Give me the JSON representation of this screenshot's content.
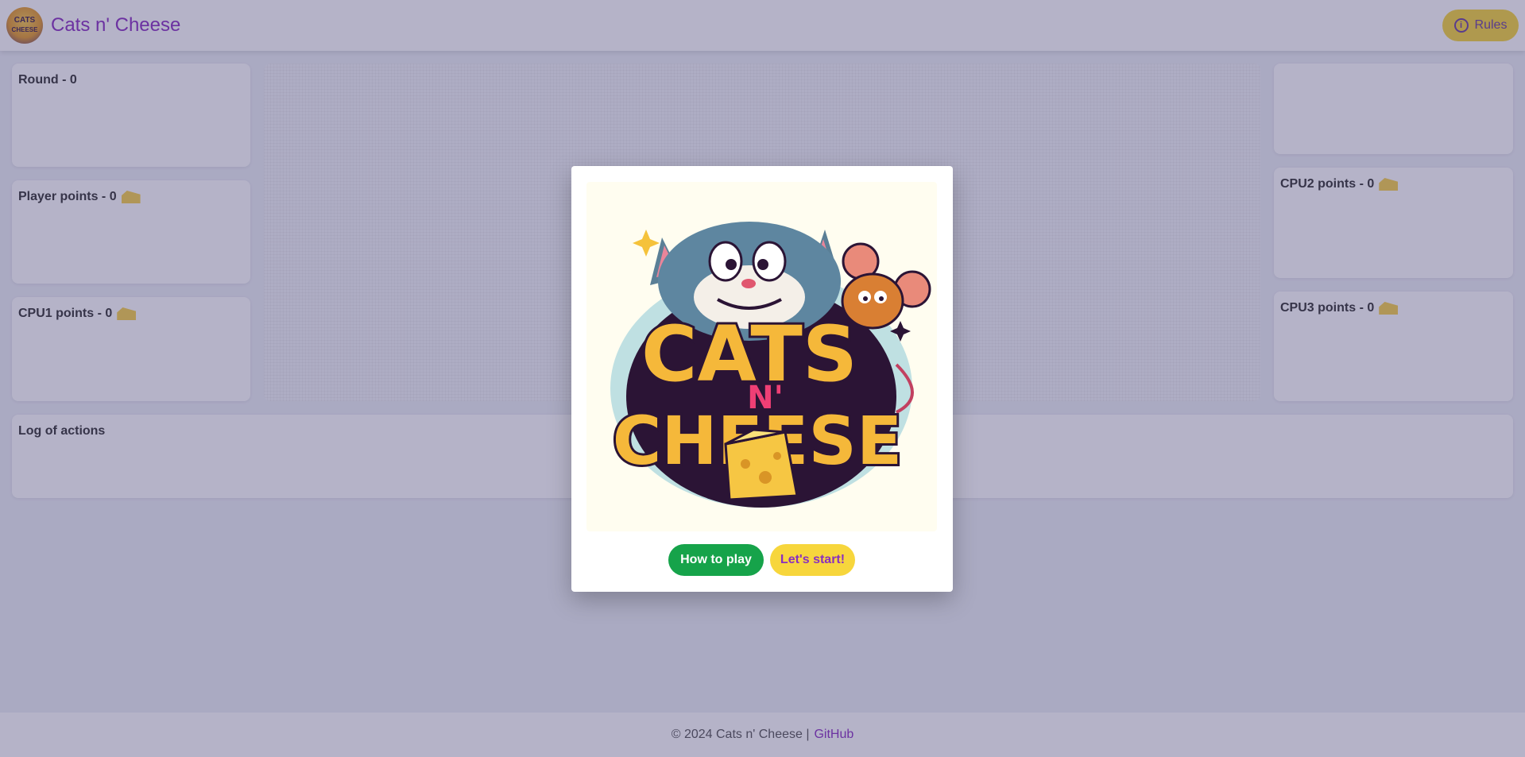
{
  "app": {
    "title": "Cats n' Cheese",
    "logo_text_top": "CATS",
    "logo_text_bottom": "CHEESE"
  },
  "header": {
    "rules_label": "Rules",
    "rules_icon": "info-icon",
    "info_glyph": "i"
  },
  "panels": {
    "round": "Round - 0",
    "player_points": "Player points - 0",
    "cpu1_points": "CPU1 points - 0",
    "cpu2_points": "CPU2 points - 0",
    "cpu3_points": "CPU3 points - 0",
    "log_title": "Log of actions",
    "points_icon": "cheese-icon"
  },
  "modal": {
    "hero_title_line1": "CATS",
    "hero_title_mid": "N'",
    "hero_title_line2": "CHEESE",
    "how_to_play_label": "How to play",
    "start_label": "Let's start!"
  },
  "footer": {
    "copyright": "© 2024 Cats n' Cheese |",
    "github_link": "GitHub"
  },
  "colors": {
    "brand": "#8a2fc0",
    "rules_button": "#f5d63a",
    "how_to_play_button": "#16a34a",
    "start_button": "#f7d63c",
    "overlay": "rgba(60,55,110,0.38)"
  }
}
